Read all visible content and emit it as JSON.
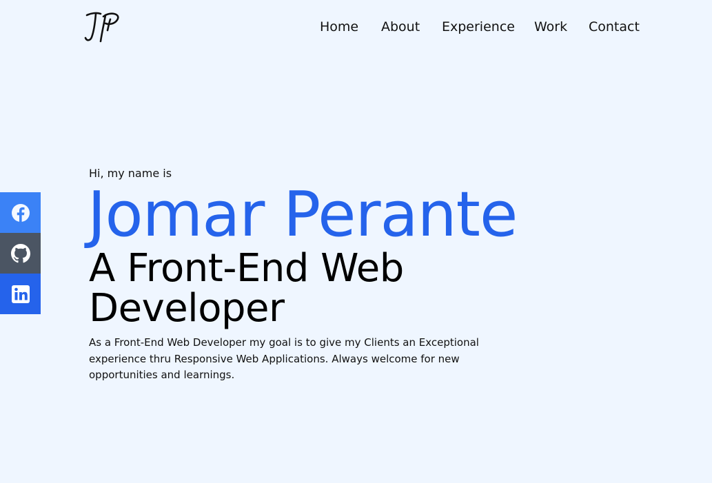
{
  "header": {
    "logo_text": "JP",
    "nav": [
      "Home",
      "About",
      "Experience",
      "Work",
      "Contact"
    ]
  },
  "social": [
    {
      "name": "facebook",
      "icon": "facebook-icon",
      "color": "#3b82f6"
    },
    {
      "name": "github",
      "icon": "github-icon",
      "color": "#4b5563"
    },
    {
      "name": "linkedin",
      "icon": "linkedin-icon",
      "color": "#2563eb"
    }
  ],
  "hero": {
    "greeting": "Hi, my name is",
    "name": "Jomar Perante",
    "role": "A Front-End Web Developer",
    "bio": "As a Front-End Web Developer my goal is to give my Clients an Exceptional experience thru Responsive Web Applications. Always welcome for new opportunities and learnings."
  },
  "colors": {
    "background": "#eff6ff",
    "accent": "#2563eb"
  }
}
